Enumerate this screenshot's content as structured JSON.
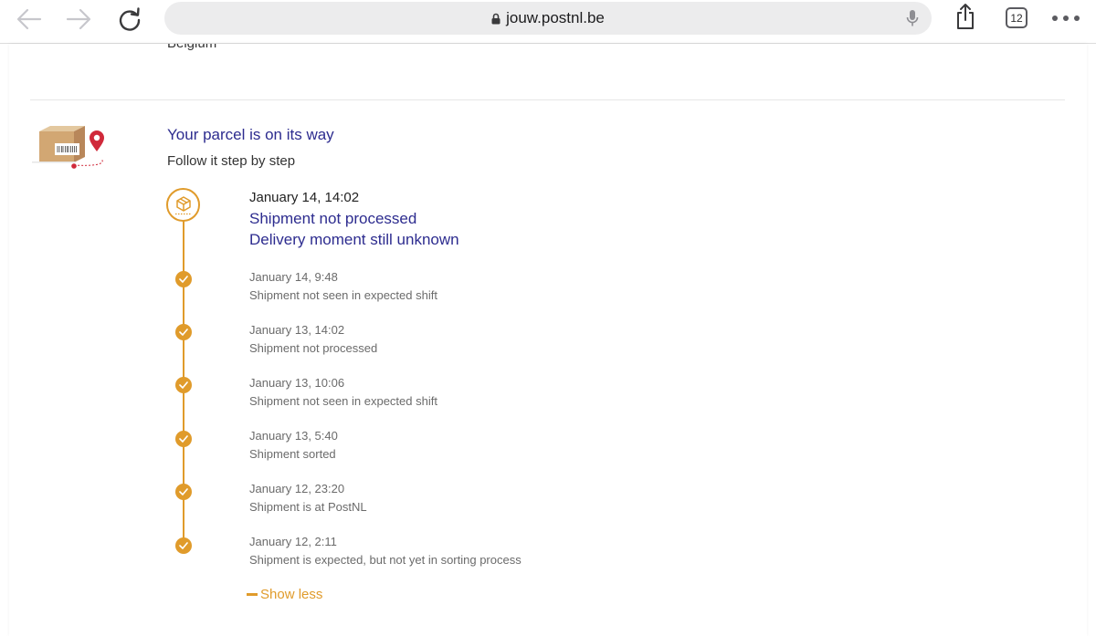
{
  "browser": {
    "url": "jouw.postnl.be",
    "tab_count": "12"
  },
  "page": {
    "cut_off_text": "Belgium",
    "section_title": "Your parcel is on its way",
    "section_subtitle": "Follow it step by step",
    "current": {
      "date": "January 14, 14:02",
      "status": "Shipment not processed",
      "note": "Delivery moment still unknown"
    },
    "events": [
      {
        "date": "January 14, 9:48",
        "description": "Shipment not seen in expected shift"
      },
      {
        "date": "January 13, 14:02",
        "description": "Shipment not processed"
      },
      {
        "date": "January 13, 10:06",
        "description": "Shipment not seen in expected shift"
      },
      {
        "date": "January 13, 5:40",
        "description": "Shipment sorted"
      },
      {
        "date": "January 12, 23:20",
        "description": "Shipment is at PostNL"
      },
      {
        "date": "January 12, 2:11",
        "description": "Shipment is expected, but not yet in sorting process"
      }
    ],
    "show_less_label": "Show less"
  },
  "colors": {
    "accent_orange": "#e09b2b",
    "heading_blue": "#2d2c8f",
    "muted_text": "#6b6b6b"
  },
  "icons": {
    "back": "arrow-left-icon",
    "forward": "arrow-right-icon",
    "reload": "reload-icon",
    "lock": "lock-icon",
    "mic": "microphone-icon",
    "share": "share-icon",
    "more": "more-dots-icon",
    "parcel": "parcel-location-icon",
    "main_step": "package-icon",
    "step": "check-icon"
  }
}
